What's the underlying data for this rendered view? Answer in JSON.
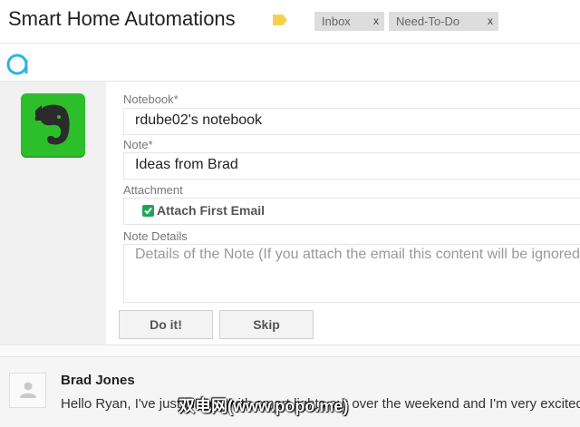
{
  "header": {
    "subject": "Smart Home Automations",
    "labels": [
      {
        "name": "Inbox",
        "close": "x"
      },
      {
        "name": "Need-To-Do",
        "close": "x"
      }
    ],
    "tag_color": "#f6d04d"
  },
  "toolbar": {
    "app_icon": "circle-a-icon",
    "accent": "#2ab4e6"
  },
  "form": {
    "notebook_label": "Notebook*",
    "notebook_value": "rdube02's notebook",
    "note_label": "Note*",
    "note_value": "Ideas from Brad",
    "attachment_label": "Attachment",
    "attach_checkbox_label": "Attach First Email",
    "attach_checked": true,
    "details_label": "Note Details",
    "details_placeholder": "Details of the Note (If you attach the email this content will be ignored)",
    "do_button": "Do it!",
    "skip_button": "Skip"
  },
  "integration": {
    "icon": "evernote-elephant-icon",
    "brand_color": "#2dbe2c"
  },
  "email": {
    "sender": "Brad Jones",
    "snippet": "Hello Ryan, I've just played with smart lights out over the weekend and I'm very excited"
  },
  "watermark": "双电网(www.popo.me)"
}
